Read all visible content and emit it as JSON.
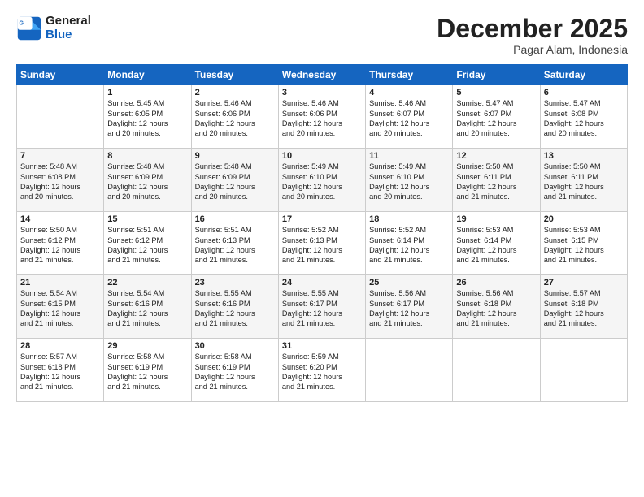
{
  "logo": {
    "line1": "General",
    "line2": "Blue"
  },
  "title": "December 2025",
  "location": "Pagar Alam, Indonesia",
  "days_of_week": [
    "Sunday",
    "Monday",
    "Tuesday",
    "Wednesday",
    "Thursday",
    "Friday",
    "Saturday"
  ],
  "weeks": [
    [
      {
        "day": "",
        "info": ""
      },
      {
        "day": "1",
        "info": "Sunrise: 5:45 AM\nSunset: 6:05 PM\nDaylight: 12 hours\nand 20 minutes."
      },
      {
        "day": "2",
        "info": "Sunrise: 5:46 AM\nSunset: 6:06 PM\nDaylight: 12 hours\nand 20 minutes."
      },
      {
        "day": "3",
        "info": "Sunrise: 5:46 AM\nSunset: 6:06 PM\nDaylight: 12 hours\nand 20 minutes."
      },
      {
        "day": "4",
        "info": "Sunrise: 5:46 AM\nSunset: 6:07 PM\nDaylight: 12 hours\nand 20 minutes."
      },
      {
        "day": "5",
        "info": "Sunrise: 5:47 AM\nSunset: 6:07 PM\nDaylight: 12 hours\nand 20 minutes."
      },
      {
        "day": "6",
        "info": "Sunrise: 5:47 AM\nSunset: 6:08 PM\nDaylight: 12 hours\nand 20 minutes."
      }
    ],
    [
      {
        "day": "7",
        "info": "Sunrise: 5:48 AM\nSunset: 6:08 PM\nDaylight: 12 hours\nand 20 minutes."
      },
      {
        "day": "8",
        "info": "Sunrise: 5:48 AM\nSunset: 6:09 PM\nDaylight: 12 hours\nand 20 minutes."
      },
      {
        "day": "9",
        "info": "Sunrise: 5:48 AM\nSunset: 6:09 PM\nDaylight: 12 hours\nand 20 minutes."
      },
      {
        "day": "10",
        "info": "Sunrise: 5:49 AM\nSunset: 6:10 PM\nDaylight: 12 hours\nand 20 minutes."
      },
      {
        "day": "11",
        "info": "Sunrise: 5:49 AM\nSunset: 6:10 PM\nDaylight: 12 hours\nand 20 minutes."
      },
      {
        "day": "12",
        "info": "Sunrise: 5:50 AM\nSunset: 6:11 PM\nDaylight: 12 hours\nand 21 minutes."
      },
      {
        "day": "13",
        "info": "Sunrise: 5:50 AM\nSunset: 6:11 PM\nDaylight: 12 hours\nand 21 minutes."
      }
    ],
    [
      {
        "day": "14",
        "info": "Sunrise: 5:50 AM\nSunset: 6:12 PM\nDaylight: 12 hours\nand 21 minutes."
      },
      {
        "day": "15",
        "info": "Sunrise: 5:51 AM\nSunset: 6:12 PM\nDaylight: 12 hours\nand 21 minutes."
      },
      {
        "day": "16",
        "info": "Sunrise: 5:51 AM\nSunset: 6:13 PM\nDaylight: 12 hours\nand 21 minutes."
      },
      {
        "day": "17",
        "info": "Sunrise: 5:52 AM\nSunset: 6:13 PM\nDaylight: 12 hours\nand 21 minutes."
      },
      {
        "day": "18",
        "info": "Sunrise: 5:52 AM\nSunset: 6:14 PM\nDaylight: 12 hours\nand 21 minutes."
      },
      {
        "day": "19",
        "info": "Sunrise: 5:53 AM\nSunset: 6:14 PM\nDaylight: 12 hours\nand 21 minutes."
      },
      {
        "day": "20",
        "info": "Sunrise: 5:53 AM\nSunset: 6:15 PM\nDaylight: 12 hours\nand 21 minutes."
      }
    ],
    [
      {
        "day": "21",
        "info": "Sunrise: 5:54 AM\nSunset: 6:15 PM\nDaylight: 12 hours\nand 21 minutes."
      },
      {
        "day": "22",
        "info": "Sunrise: 5:54 AM\nSunset: 6:16 PM\nDaylight: 12 hours\nand 21 minutes."
      },
      {
        "day": "23",
        "info": "Sunrise: 5:55 AM\nSunset: 6:16 PM\nDaylight: 12 hours\nand 21 minutes."
      },
      {
        "day": "24",
        "info": "Sunrise: 5:55 AM\nSunset: 6:17 PM\nDaylight: 12 hours\nand 21 minutes."
      },
      {
        "day": "25",
        "info": "Sunrise: 5:56 AM\nSunset: 6:17 PM\nDaylight: 12 hours\nand 21 minutes."
      },
      {
        "day": "26",
        "info": "Sunrise: 5:56 AM\nSunset: 6:18 PM\nDaylight: 12 hours\nand 21 minutes."
      },
      {
        "day": "27",
        "info": "Sunrise: 5:57 AM\nSunset: 6:18 PM\nDaylight: 12 hours\nand 21 minutes."
      }
    ],
    [
      {
        "day": "28",
        "info": "Sunrise: 5:57 AM\nSunset: 6:18 PM\nDaylight: 12 hours\nand 21 minutes."
      },
      {
        "day": "29",
        "info": "Sunrise: 5:58 AM\nSunset: 6:19 PM\nDaylight: 12 hours\nand 21 minutes."
      },
      {
        "day": "30",
        "info": "Sunrise: 5:58 AM\nSunset: 6:19 PM\nDaylight: 12 hours\nand 21 minutes."
      },
      {
        "day": "31",
        "info": "Sunrise: 5:59 AM\nSunset: 6:20 PM\nDaylight: 12 hours\nand 21 minutes."
      },
      {
        "day": "",
        "info": ""
      },
      {
        "day": "",
        "info": ""
      },
      {
        "day": "",
        "info": ""
      }
    ]
  ]
}
